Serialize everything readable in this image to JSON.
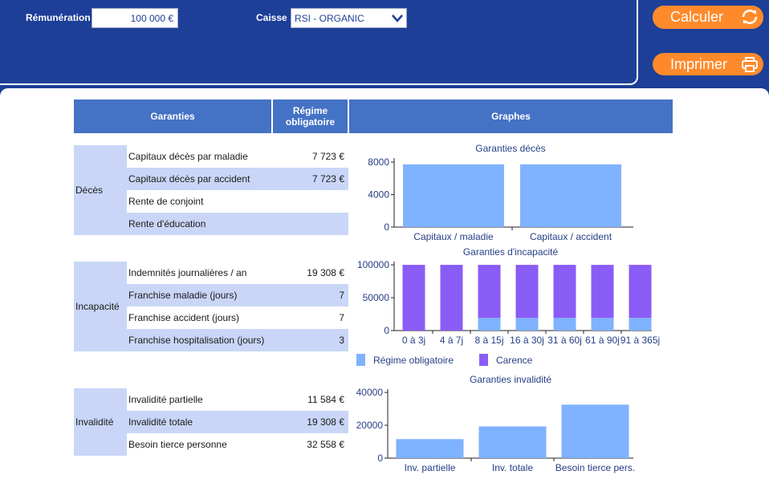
{
  "form": {
    "remuneration_label": "Rémunération",
    "remuneration_value": "100 000 €",
    "caisse_label": "Caisse",
    "caisse_value": "RSI - ORGANIC"
  },
  "buttons": {
    "calculer": "Calculer",
    "imprimer": "Imprimer"
  },
  "table": {
    "header": {
      "garanties": "Garanties",
      "regime_line1": "Régime",
      "regime_line2": "obligatoire",
      "graphes": "Graphes"
    },
    "groups": [
      {
        "name": "Décès",
        "rows": [
          {
            "label": "Capitaux décès par maladie",
            "value": "7 723 €"
          },
          {
            "label": "Capitaux décès par accident",
            "value": "7 723 €"
          },
          {
            "label": "Rente de conjoint",
            "value": ""
          },
          {
            "label": "Rente d'éducation",
            "value": ""
          }
        ]
      },
      {
        "name": "Incapacité",
        "rows": [
          {
            "label": "Indemnités journalières / an",
            "value": "19 308 €"
          },
          {
            "label": "Franchise maladie (jours)",
            "value": "7"
          },
          {
            "label": "Franchise accident (jours)",
            "value": "7"
          },
          {
            "label": "Franchise hospitalisation (jours)",
            "value": "3"
          }
        ]
      },
      {
        "name": "Invalidité",
        "rows": [
          {
            "label": "Invalidité partielle",
            "value": "11 584 €"
          },
          {
            "label": "Invalidité totale",
            "value": "19 308 €"
          },
          {
            "label": "Besoin tierce personne",
            "value": "32 558 €"
          }
        ]
      }
    ]
  },
  "colors": {
    "bar_light": "#7fb2ff",
    "bar_purple": "#8a5cf6",
    "header_blue": "#4472c4",
    "row_alt": "#c9d6f7",
    "accent_orange": "#ff8a2b"
  },
  "chart_data": [
    {
      "type": "bar",
      "title": "Garanties décès",
      "categories": [
        "Capitaux / maladie",
        "Capitaux / accident"
      ],
      "values": [
        7723,
        7723
      ],
      "yticks": [
        0,
        4000,
        8000
      ],
      "ylim": [
        0,
        8500
      ]
    },
    {
      "type": "bar",
      "title": "Garanties d'incapacité",
      "stacked": true,
      "categories": [
        "0 à 3j",
        "4 à 7j",
        "8 à 15j",
        "16 à 30j",
        "31 à 60j",
        "61 à 90j",
        "91 à 365j"
      ],
      "series": [
        {
          "name": "Régime obligatoire",
          "values": [
            0,
            0,
            19308,
            19308,
            19308,
            19308,
            19308
          ]
        },
        {
          "name": "Carence",
          "values": [
            100000,
            100000,
            80692,
            80692,
            80692,
            80692,
            80692
          ]
        }
      ],
      "yticks": [
        0,
        50000,
        100000
      ],
      "ylim": [
        0,
        105000
      ],
      "legend": "bottom"
    },
    {
      "type": "bar",
      "title": "Garanties invalidité",
      "categories": [
        "Inv. partielle",
        "Inv. totale",
        "Besoin tierce pers."
      ],
      "values": [
        11584,
        19308,
        32558
      ],
      "yticks": [
        0,
        20000,
        40000
      ],
      "ylim": [
        0,
        42000
      ]
    }
  ]
}
